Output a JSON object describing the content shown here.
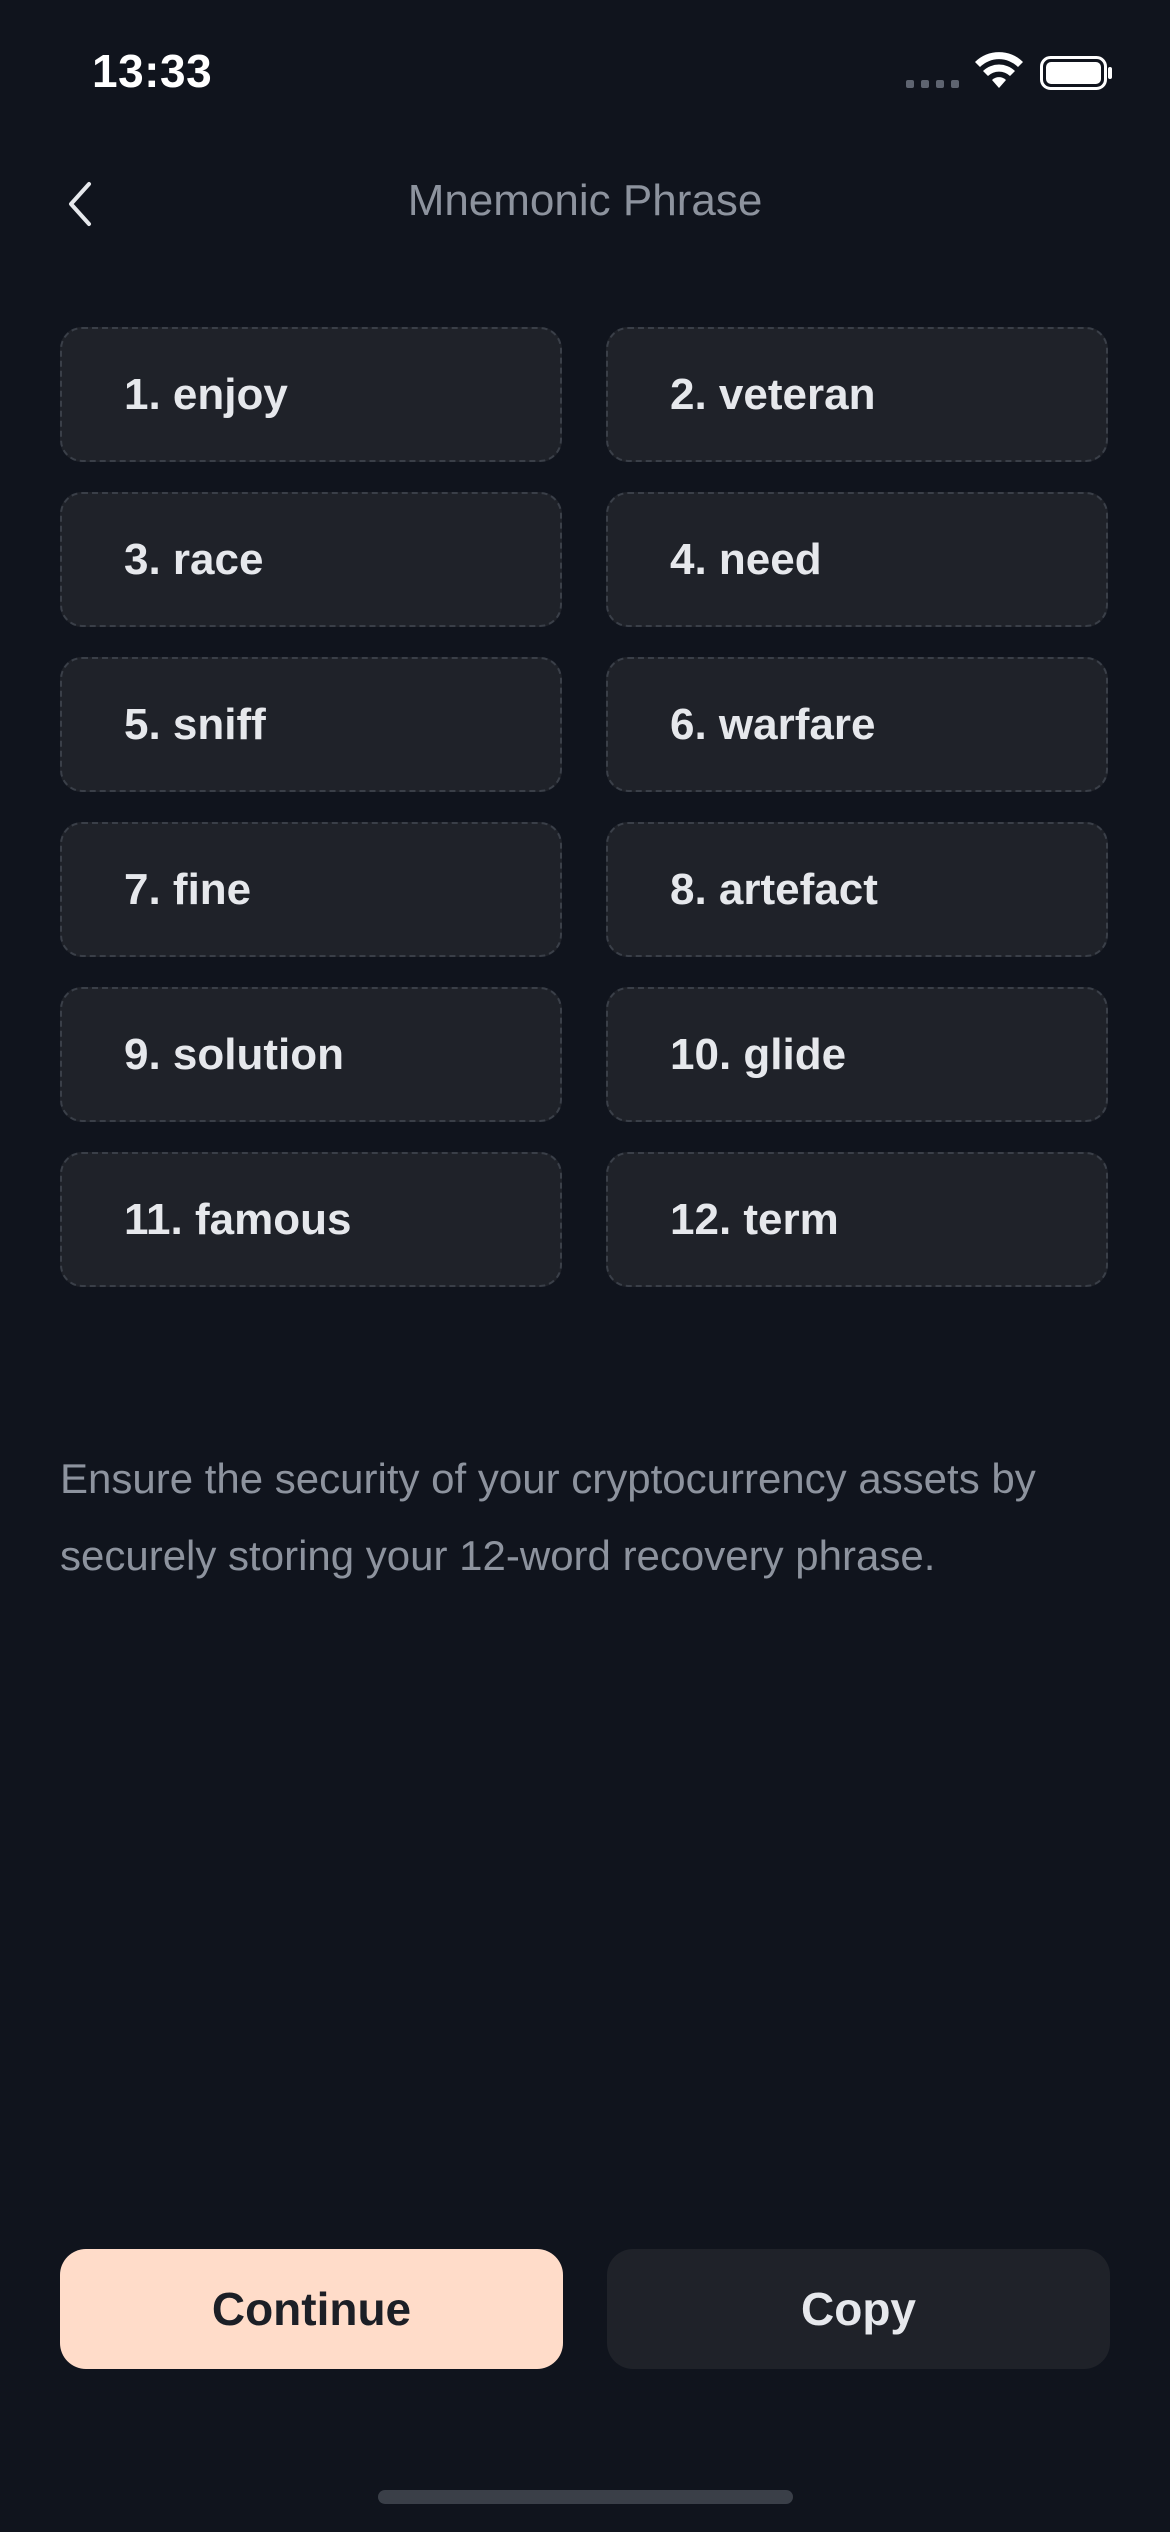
{
  "status_bar": {
    "time": "13:33"
  },
  "header": {
    "title": "Mnemonic Phrase",
    "back_icon": "chevron-left-icon"
  },
  "words": [
    "1. enjoy",
    "2. veteran",
    "3. race",
    "4. need",
    "5. sniff",
    "6. warfare",
    "7. fine",
    "8. artefact",
    "9. solution",
    "10. glide",
    "11. famous",
    "12. term"
  ],
  "description": "Ensure the security of your cryptocurrency assets by securely storing your 12-word recovery phrase.",
  "actions": {
    "continue_label": "Continue",
    "copy_label": "Copy"
  },
  "colors": {
    "background": "#10141d",
    "card": "#1f2229",
    "accent": "#ffdcc9",
    "muted_text": "#8d939e"
  }
}
